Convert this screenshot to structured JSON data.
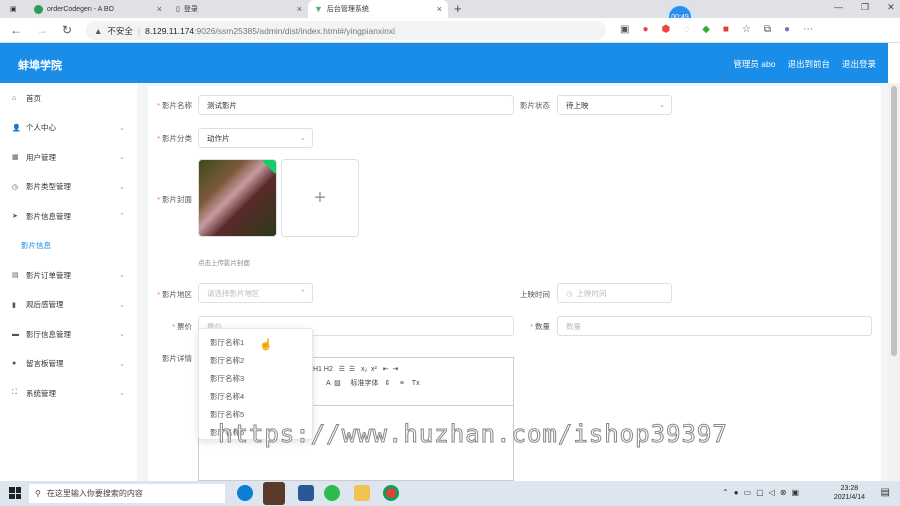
{
  "browser": {
    "tabs": [
      {
        "label": "orderCodegen - A BO"
      },
      {
        "label": "登录"
      },
      {
        "label": "后台管理系统"
      }
    ],
    "new_tab": "+",
    "timer": "00:49",
    "security": "不安全",
    "url_host": "8.129.11.174",
    "url_path": ":9026/ssm25385/admin/dist/index.html#/yingpianxinxi"
  },
  "header": {
    "brand": "蚌埠学院",
    "admin": "管理员 abo",
    "to_front": "退出到前台",
    "logout": "退出登录"
  },
  "sidebar": {
    "items": [
      {
        "label": "首页",
        "icon": "home-icon",
        "chev": ""
      },
      {
        "label": "个人中心",
        "icon": "user-icon",
        "chev": "⌄"
      },
      {
        "label": "用户管理",
        "icon": "users-icon",
        "chev": "⌄"
      },
      {
        "label": "影片类型管理",
        "icon": "clock-icon",
        "chev": "⌄"
      },
      {
        "label": "影片信息管理",
        "icon": "send-icon",
        "chev": "⌃"
      },
      {
        "label": "影片信息",
        "icon": "",
        "chev": ""
      },
      {
        "label": "影片订单管理",
        "icon": "grid-icon",
        "chev": "⌄"
      },
      {
        "label": "观后感管理",
        "icon": "chart-icon",
        "chev": "⌄"
      },
      {
        "label": "影厅信息管理",
        "icon": "chat-icon",
        "chev": "⌄"
      },
      {
        "label": "留言板管理",
        "icon": "pin-icon",
        "chev": "⌄"
      },
      {
        "label": "系统管理",
        "icon": "expand-icon",
        "chev": "⌄"
      }
    ]
  },
  "form": {
    "name_label": "影片名称",
    "name_value": "测试影片",
    "status_label": "影片状态",
    "status_value": "待上映",
    "category_label": "影片分类",
    "category_value": "动作片",
    "cover_label": "影片封面",
    "upload_hint": "点击上传影片封面",
    "plus": "+",
    "region_label": "影片地区",
    "region_placeholder": "请选择影片地区",
    "release_label": "上映时间",
    "release_placeholder": "上映时间",
    "price_label": "票价",
    "price_placeholder": "票价",
    "qty_label": "数量",
    "qty_placeholder": "数量",
    "detail_label": "影片详情"
  },
  "dropdown": {
    "options": [
      "影厅名称1",
      "影厅名称2",
      "影厅名称3",
      "影厅名称4",
      "影厅名称5",
      "影厅名称6"
    ]
  },
  "editor": {
    "tools1": "H1 H2   ☰  ☰   x₂  x²   ⇤  ⇥",
    "tools2": "A  ▨     标准字体   ⇕     ≡    Tx"
  },
  "watermark": "https://www.huzhan.com/ishop39397",
  "taskbar": {
    "search_placeholder": "在这里输入你要搜索的内容",
    "time": "23:28",
    "date": "2021/4/14"
  }
}
